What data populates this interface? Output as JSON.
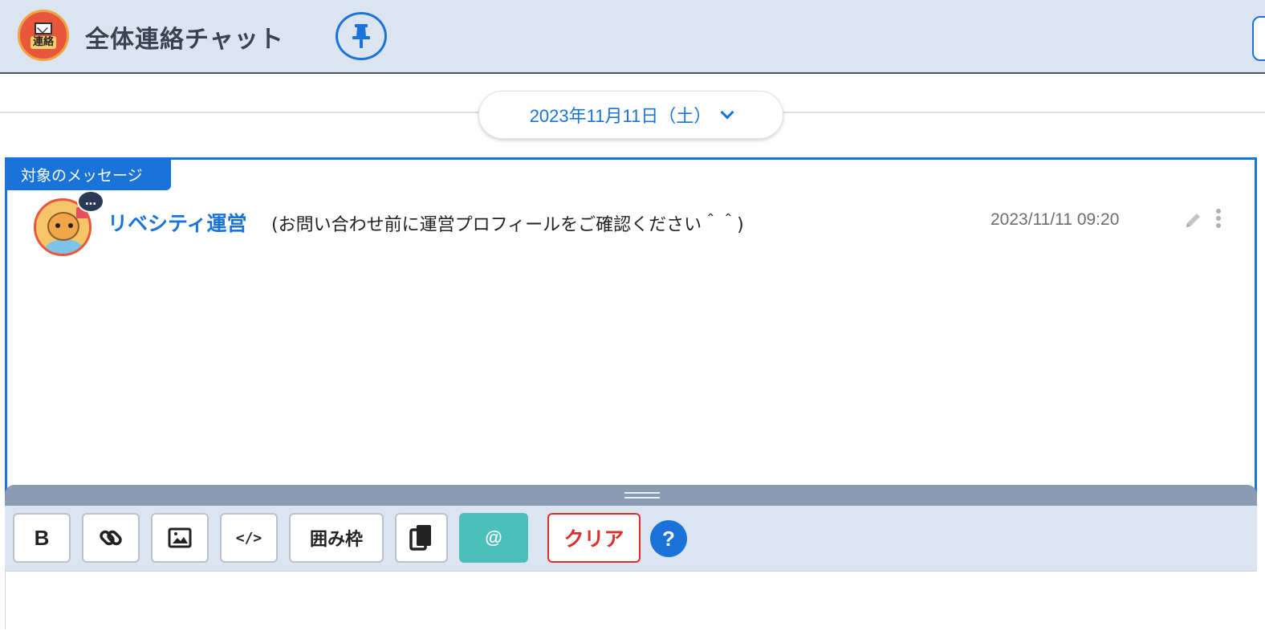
{
  "header": {
    "channel_icon_text": "連絡",
    "title": "全体連絡チャット"
  },
  "date_divider": {
    "label": "2023年11月11日（土）"
  },
  "message_panel": {
    "target_label": "対象のメッセージ",
    "status_bubble": "…",
    "sender_name": "リベシティ運営",
    "sender_note": "(お問い合わせ前に運営プロフィールをご確認ください＾＾)",
    "timestamp": "2023/11/11 09:20"
  },
  "toolbar": {
    "bold_label": "B",
    "code_label": "</>",
    "frame_label": "囲み枠",
    "mention_label": "@",
    "clear_label": "クリア",
    "help_label": "?"
  },
  "colors": {
    "accent": "#1a73d9",
    "header_bg": "#dce4f0",
    "mention_bg": "#4bbfba",
    "clear_red": "#d9302c"
  },
  "icons": [
    "pin-icon",
    "chevron-down-icon",
    "link-icon",
    "image-icon",
    "copy-icon",
    "pencil-icon",
    "more-vertical-icon",
    "help-icon"
  ]
}
